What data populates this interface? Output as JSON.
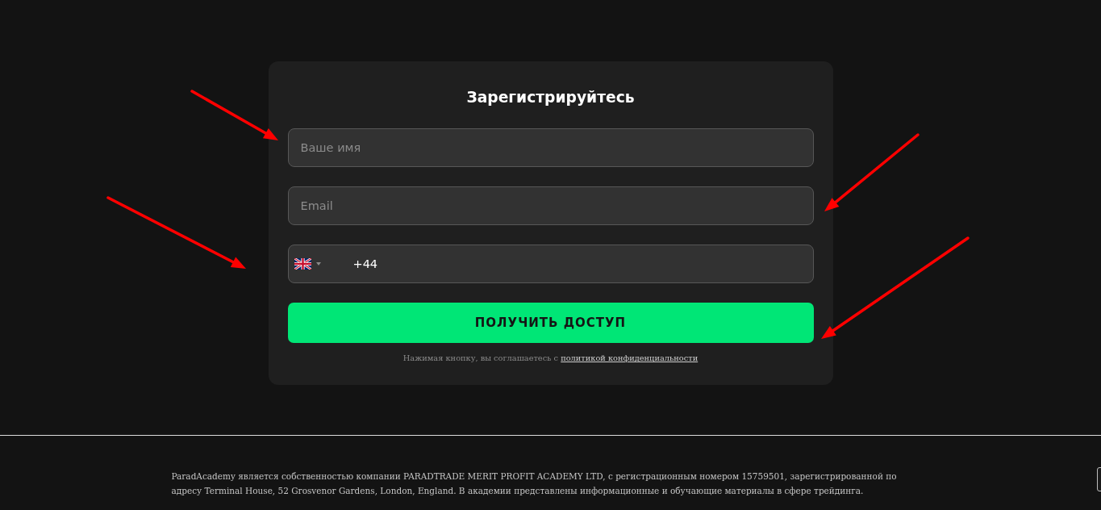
{
  "form": {
    "title": "Зарегистрируйтесь",
    "fields": [
      {
        "kind": "text",
        "placeholder": "Ваше имя"
      },
      {
        "kind": "text",
        "placeholder": "Email"
      },
      {
        "kind": "phone",
        "value": "+44"
      }
    ],
    "submit_button": "ПОЛУЧИТЬ ДОСТУП",
    "consent": {
      "text": "Нажимая кнопку, вы соглашаетесь с",
      "link": "политикой конфиденциальности"
    }
  },
  "footer": {
    "text": "ParadAcademy является собственностью компании PARADTRADE MERIT PROFIT ACADEMY LTD, с регистрационным номером 15759501, зарегистрированной по адресу Terminal House, 52 Grosvenor Gardens, London, England. В академии представлены информационные и обучающие материалы в сфере трейдинга."
  }
}
